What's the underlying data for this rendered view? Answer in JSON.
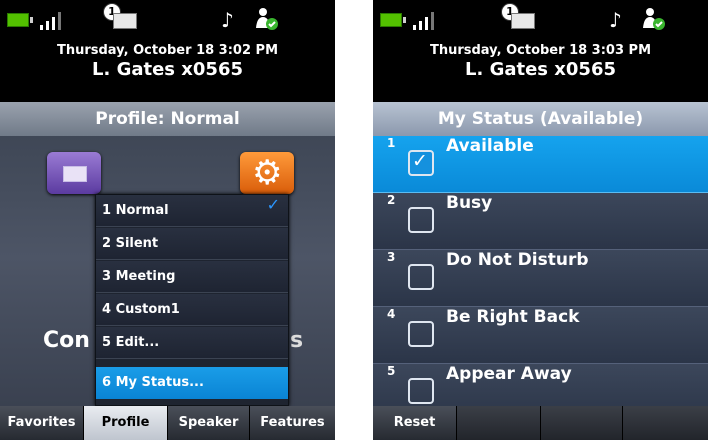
{
  "left_screen": {
    "status": {
      "message_count": "1",
      "icons": [
        "battery-icon",
        "signal-icon",
        "voicemail-icon",
        "music-note-icon",
        "presence-icon"
      ]
    },
    "header": {
      "datetime": "Thursday, October 18 3:02 PM",
      "user": "L. Gates x0565"
    },
    "title": "Profile: Normal",
    "background_text_left": "Con",
    "background_text_right": "s",
    "menu": {
      "items": [
        {
          "num": "1",
          "label": "Normal",
          "checked": true
        },
        {
          "num": "2",
          "label": "Silent"
        },
        {
          "num": "3",
          "label": "Meeting"
        },
        {
          "num": "4",
          "label": "Custom1"
        },
        {
          "num": "5",
          "label": "Edit..."
        },
        {
          "num": "6",
          "label": "My Status...",
          "selected": true
        }
      ],
      "check_glyph": "✓"
    },
    "softkeys": [
      "Favorites",
      "Profile",
      "Speaker",
      "Features"
    ],
    "active_softkey": "Profile"
  },
  "right_screen": {
    "status": {
      "message_count": "1",
      "icons": [
        "battery-icon",
        "signal-icon",
        "voicemail-icon",
        "music-note-icon",
        "presence-icon"
      ]
    },
    "header": {
      "datetime": "Thursday, October 18 3:03 PM",
      "user": "L. Gates x0565"
    },
    "title": "My Status (Available)",
    "rows": [
      {
        "num": "1",
        "label": "Available",
        "checked": true,
        "check": "✓"
      },
      {
        "num": "2",
        "label": "Busy",
        "checked": false,
        "check": ""
      },
      {
        "num": "3",
        "label": "Do Not Disturb",
        "checked": false,
        "check": ""
      },
      {
        "num": "4",
        "label": "Be Right Back",
        "checked": false,
        "check": ""
      },
      {
        "num": "5",
        "label": "Appear Away",
        "checked": false,
        "check": ""
      }
    ],
    "softkeys": [
      "Reset",
      "",
      "",
      ""
    ]
  },
  "colors": {
    "selection_blue": "#0a8ad8",
    "battery_green": "#53c000"
  }
}
